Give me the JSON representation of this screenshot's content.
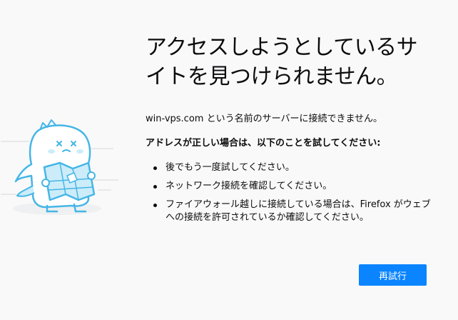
{
  "error": {
    "title": "アクセスしようとしているサイトを見つけられません。",
    "description": "win-vps.com という名前のサーバーに接続できません。",
    "subheading": "アドレスが正しい場合は、以下のことを試してください:",
    "tips": [
      "後でもう一度試してください。",
      "ネットワーク接続を確認してください。",
      "ファイアウォール越しに接続している場合は、Firefox がウェブへの接続を許可されているか確認してください。"
    ],
    "retry_label": "再試行",
    "illustration_icon": "dino-with-map-illustration"
  },
  "colors": {
    "background": "#f9f9fa",
    "accent": "#0a84ff",
    "illustration_stroke": "#45b6e6",
    "illustration_fill": "#ccecfa"
  }
}
